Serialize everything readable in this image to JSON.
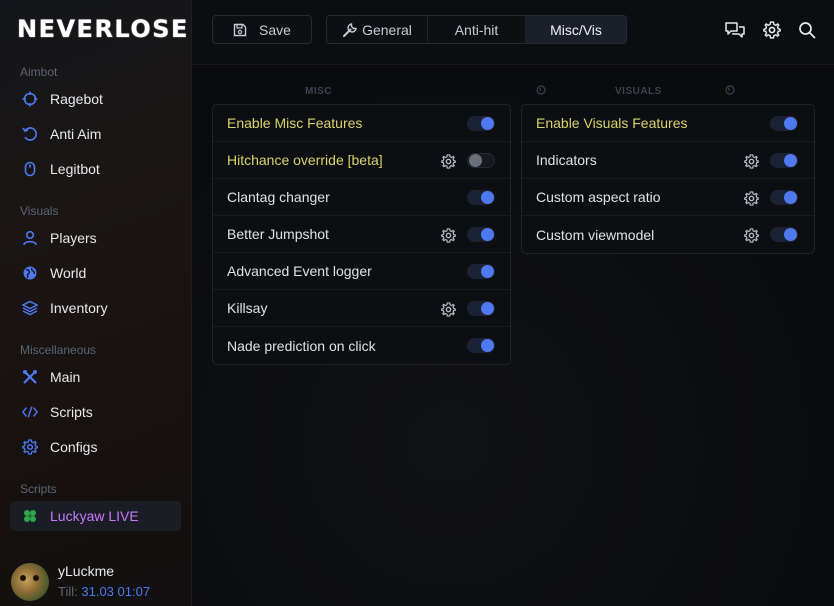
{
  "app": {
    "logo": "NEVERLOSE"
  },
  "sidebar": {
    "sections": [
      {
        "label": "Aimbot",
        "items": [
          {
            "label": "Ragebot",
            "icon": "crosshair-icon"
          },
          {
            "label": "Anti Aim",
            "icon": "rotate-icon"
          },
          {
            "label": "Legitbot",
            "icon": "mouse-icon"
          }
        ]
      },
      {
        "label": "Visuals",
        "items": [
          {
            "label": "Players",
            "icon": "user-icon"
          },
          {
            "label": "World",
            "icon": "globe-icon"
          },
          {
            "label": "Inventory",
            "icon": "layers-icon"
          }
        ]
      },
      {
        "label": "Miscellaneous",
        "items": [
          {
            "label": "Main",
            "icon": "tools-icon"
          },
          {
            "label": "Scripts",
            "icon": "code-icon"
          },
          {
            "label": "Configs",
            "icon": "gear-icon"
          }
        ]
      },
      {
        "label": "Scripts",
        "items": [
          {
            "label": "Luckyaw LIVE",
            "icon": "clover-icon",
            "active": true
          }
        ]
      }
    ],
    "user": {
      "name": "yLuckme",
      "till_label": "Till:",
      "till_date": "31.03 01:07"
    }
  },
  "topbar": {
    "save_label": "Save",
    "tabs": [
      {
        "label": "General",
        "icon": "wrench-icon"
      },
      {
        "label": "Anti-hit"
      },
      {
        "label": "Misc/Vis",
        "active": true
      }
    ],
    "icons": [
      "chat-icon",
      "gear-icon",
      "search-icon"
    ]
  },
  "misc": {
    "header": "MISC",
    "rows": [
      {
        "label": "Enable Misc Features",
        "highlight": true,
        "gear": false,
        "on": true
      },
      {
        "label": "Hitchance override [beta]",
        "highlight": true,
        "gear": true,
        "on": false
      },
      {
        "label": "Clantag changer",
        "gear": false,
        "on": true
      },
      {
        "label": "Better Jumpshot",
        "gear": true,
        "on": true
      },
      {
        "label": "Advanced Event logger",
        "gear": false,
        "on": true
      },
      {
        "label": "Killsay",
        "gear": true,
        "on": true
      },
      {
        "label": "Nade prediction on click",
        "gear": false,
        "on": true
      }
    ]
  },
  "visuals": {
    "header": "VISUALS",
    "rows": [
      {
        "label": "Enable Visuals Features",
        "highlight": true,
        "gear": false,
        "on": true
      },
      {
        "label": "Indicators",
        "gear": true,
        "on": true
      },
      {
        "label": "Custom aspect ratio",
        "gear": true,
        "on": true
      },
      {
        "label": "Custom viewmodel",
        "gear": true,
        "on": true
      }
    ]
  },
  "colors": {
    "accent": "#4f79f0",
    "highlight_text": "#d9d46a",
    "active_script": "#c879ff"
  }
}
